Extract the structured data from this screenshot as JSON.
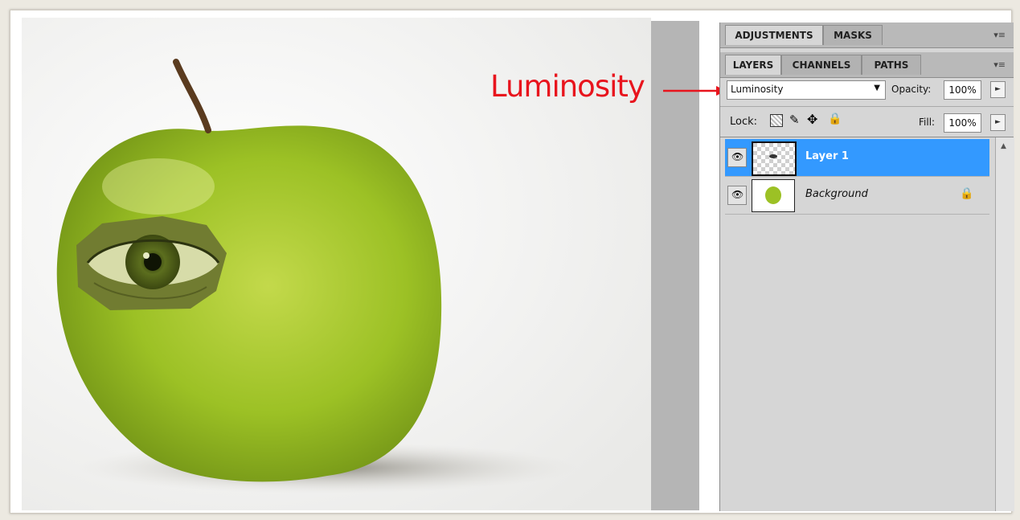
{
  "annotation": {
    "text": "Luminosity",
    "color": "#e8141d"
  },
  "panel_top": {
    "tabs": [
      "ADJUSTMENTS",
      "MASKS"
    ],
    "active_tab": "ADJUSTMENTS",
    "menu_icon": "panel-menu-icon"
  },
  "layers_panel": {
    "tabs": [
      "LAYERS",
      "CHANNELS",
      "PATHS"
    ],
    "active_tab": "LAYERS",
    "menu_icon": "panel-menu-icon",
    "blend_mode": "Luminosity",
    "opacity_label": "Opacity:",
    "opacity_value": "100%",
    "lock_label": "Lock:",
    "lock_icons": [
      "lock-transparent-icon",
      "lock-brush-icon",
      "lock-move-icon",
      "lock-all-icon"
    ],
    "fill_label": "Fill:",
    "fill_value": "100%",
    "layers": [
      {
        "name": "Layer 1",
        "selected": true,
        "visible": true,
        "locked": false,
        "thumbnail": "eye-layer-thumbnail"
      },
      {
        "name": "Background",
        "selected": false,
        "visible": true,
        "locked": true,
        "thumbnail": "apple-thumbnail"
      }
    ],
    "selection_color": "#3399ff"
  },
  "canvas": {
    "subject": "green-apple-with-eye",
    "apple_color": "#9cc125",
    "background_color": "#f3f3f1"
  }
}
